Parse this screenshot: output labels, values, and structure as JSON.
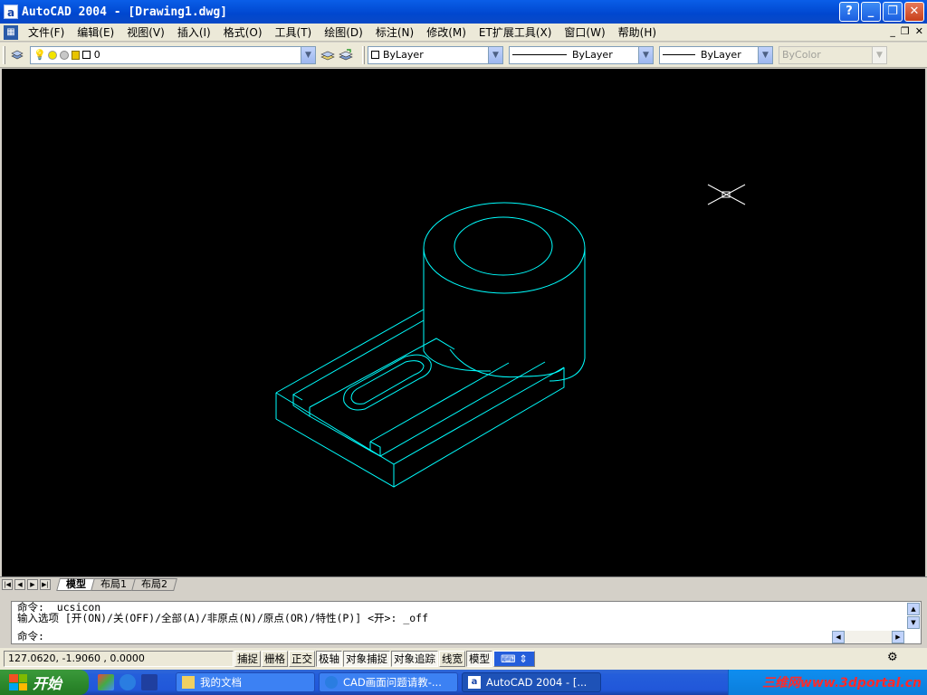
{
  "window": {
    "title": "AutoCAD 2004 - [Drawing1.dwg]",
    "app_icon_letter": "a",
    "buttons": [
      "?",
      "_",
      "❐",
      "✕"
    ]
  },
  "menu": {
    "items": [
      "文件(F)",
      "编辑(E)",
      "视图(V)",
      "插入(I)",
      "格式(O)",
      "工具(T)",
      "绘图(D)",
      "标注(N)",
      "修改(M)",
      "ET扩展工具(X)",
      "窗口(W)",
      "帮助(H)"
    ],
    "mdi_buttons": [
      "_",
      "❐",
      "✕"
    ]
  },
  "toolbar": {
    "layer_value": "0",
    "color_value": "ByLayer",
    "linetype_value": "ByLayer",
    "lineweight_value": "ByLayer",
    "plotstyle_value": "ByColor"
  },
  "layout_tabs": {
    "items": [
      "模型",
      "布局1",
      "布局2"
    ],
    "active": "模型"
  },
  "command": {
    "history": [
      "命令: _ucsicon",
      "输入选项 [开(ON)/关(OFF)/全部(A)/非原点(N)/原点(OR)/特性(P)] <开>: _off"
    ],
    "prompt": "命令:"
  },
  "status": {
    "coords": "127.0620, -1.9060 , 0.0000",
    "toggles": [
      "捕捉",
      "栅格",
      "正交",
      "极轴",
      "对象捕捉",
      "对象追踪",
      "线宽",
      "模型"
    ],
    "on_toggles": [
      "极轴",
      "对象捕捉",
      "对象追踪",
      "模型"
    ]
  },
  "taskbar": {
    "start_label": "开始",
    "tasks": [
      "我的文档",
      "CAD画面问题请教-...",
      "AutoCAD 2004 - [..."
    ],
    "active_task": "AutoCAD 2004 - [...",
    "watermark": "三维网www.3dportal.cn"
  },
  "colors": {
    "canvas": "#000000",
    "wire": "#00ffff",
    "crosshair": "#ffffff",
    "title_blue": "#0047cf",
    "taskbar_blue": "#245edb"
  }
}
